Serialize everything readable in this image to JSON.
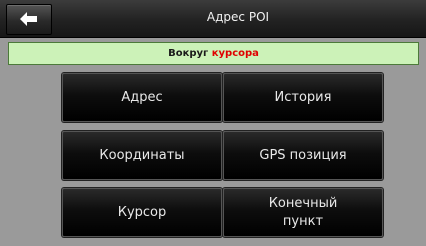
{
  "header": {
    "title": "Адрес POI"
  },
  "status": {
    "prefix": "Вокруг",
    "highlight": "курсора"
  },
  "buttons": {
    "address": "Адрес",
    "history": "История",
    "coordinates": "Координаты",
    "gps_position": "GPS позиция",
    "cursor": "Курсор",
    "destination": "Конечный\nпункт"
  },
  "icons": {
    "back": "arrow-left-icon"
  },
  "colors": {
    "status_background": "#ccf2b8",
    "highlight": "#e00000"
  }
}
